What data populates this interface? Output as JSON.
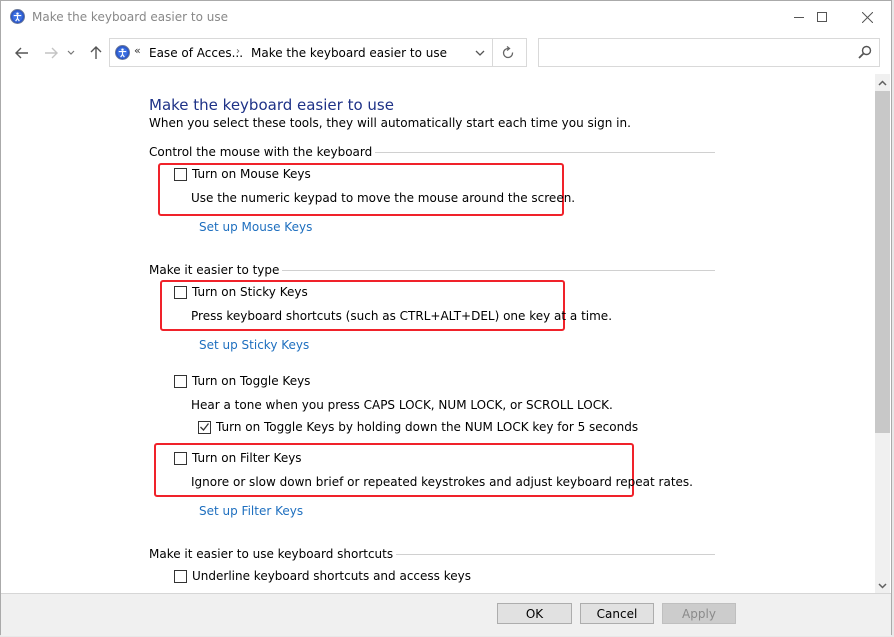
{
  "window": {
    "title": "Make the keyboard easier to use"
  },
  "nav": {
    "back_icon": "arrow-left-icon",
    "forward_icon": "arrow-right-icon",
    "recent_icon": "chevron-down-icon",
    "up_icon": "arrow-up-icon"
  },
  "address": {
    "overflow": "«",
    "crumbs": [
      "Ease of Acces...",
      "Make the keyboard easier to use"
    ],
    "separator": "›"
  },
  "search": {
    "value": "",
    "placeholder": ""
  },
  "main": {
    "title": "Make the keyboard easier to use",
    "subtitle": "When you select these tools, they will automatically start each time you sign in.",
    "groups": [
      {
        "heading": "Control the mouse with the keyboard",
        "options": [
          {
            "label": "Turn on Mouse Keys",
            "checked": false,
            "description": "Use the numeric keypad to move the mouse around the screen.",
            "link": "Set up Mouse Keys"
          }
        ]
      },
      {
        "heading": "Make it easier to type",
        "options": [
          {
            "label": "Turn on Sticky Keys",
            "checked": false,
            "description": "Press keyboard shortcuts (such as CTRL+ALT+DEL) one key at a time.",
            "link": "Set up Sticky Keys"
          },
          {
            "label": "Turn on Toggle Keys",
            "checked": false,
            "description": "Hear a tone when you press CAPS LOCK, NUM LOCK, or SCROLL LOCK.",
            "suboption": {
              "label": "Turn on Toggle Keys by holding down the NUM LOCK key for 5 seconds",
              "checked": true
            }
          },
          {
            "label": "Turn on Filter Keys",
            "checked": false,
            "description": "Ignore or slow down brief or repeated keystrokes and adjust keyboard repeat rates.",
            "link": "Set up Filter Keys"
          }
        ]
      },
      {
        "heading": "Make it easier to use keyboard shortcuts",
        "options": [
          {
            "label": "Underline keyboard shortcuts and access keys",
            "checked": false
          }
        ]
      }
    ]
  },
  "footer": {
    "ok": "OK",
    "cancel": "Cancel",
    "apply": "Apply"
  },
  "colors": {
    "title_blue": "#1e3287",
    "link_blue": "#1e6fbf",
    "highlight_red": "#f0222a"
  }
}
